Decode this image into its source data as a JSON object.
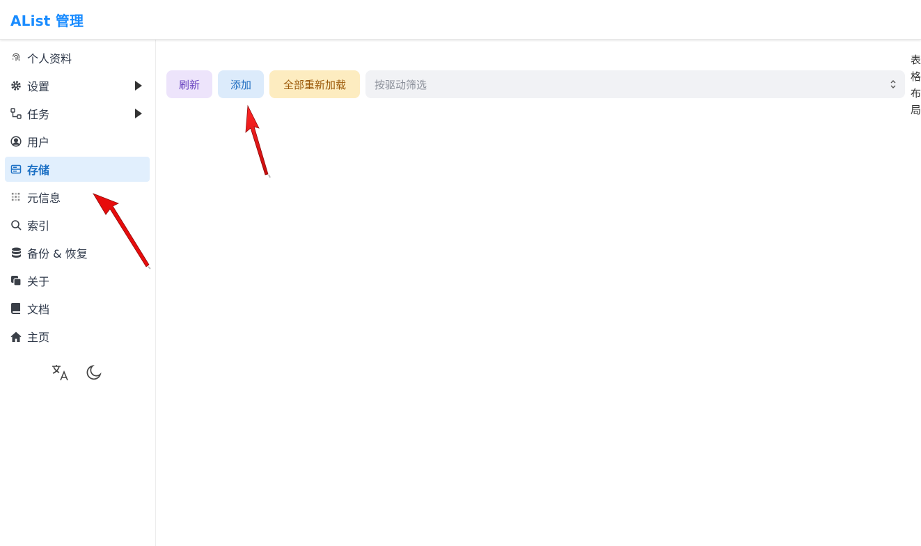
{
  "header": {
    "title": "AList 管理"
  },
  "sidebar": {
    "items": [
      {
        "label": "个人资料",
        "icon": "fingerprint-icon"
      },
      {
        "label": "设置",
        "icon": "gear-icon"
      },
      {
        "label": "任务",
        "icon": "workflow-icon"
      },
      {
        "label": "用户",
        "icon": "user-circle-icon"
      },
      {
        "label": "存储",
        "icon": "storage-icon",
        "active": true
      },
      {
        "label": "元信息",
        "icon": "meta-icon"
      },
      {
        "label": "索引",
        "icon": "search-icon"
      },
      {
        "label": "备份 & 恢复",
        "icon": "database-icon"
      },
      {
        "label": "关于",
        "icon": "copy-icon"
      },
      {
        "label": "文档",
        "icon": "book-icon"
      },
      {
        "label": "主页",
        "icon": "home-icon"
      }
    ],
    "bottom": {
      "language_icon": "translate-icon",
      "theme_icon": "moon-icon"
    }
  },
  "toolbar": {
    "refresh_label": "刷新",
    "add_label": "添加",
    "reload_all_label": "全部重新加载",
    "filter_placeholder": "按驱动筛选"
  },
  "layout_toggle": {
    "label": "表格布局"
  },
  "colors": {
    "brand": "#1a8cff",
    "active_bg": "#e1effd",
    "refresh_bg": "#ede4fb",
    "add_bg": "#dcebfb",
    "reload_bg": "#fdecc0",
    "annotation_arrow": "#e60000"
  }
}
